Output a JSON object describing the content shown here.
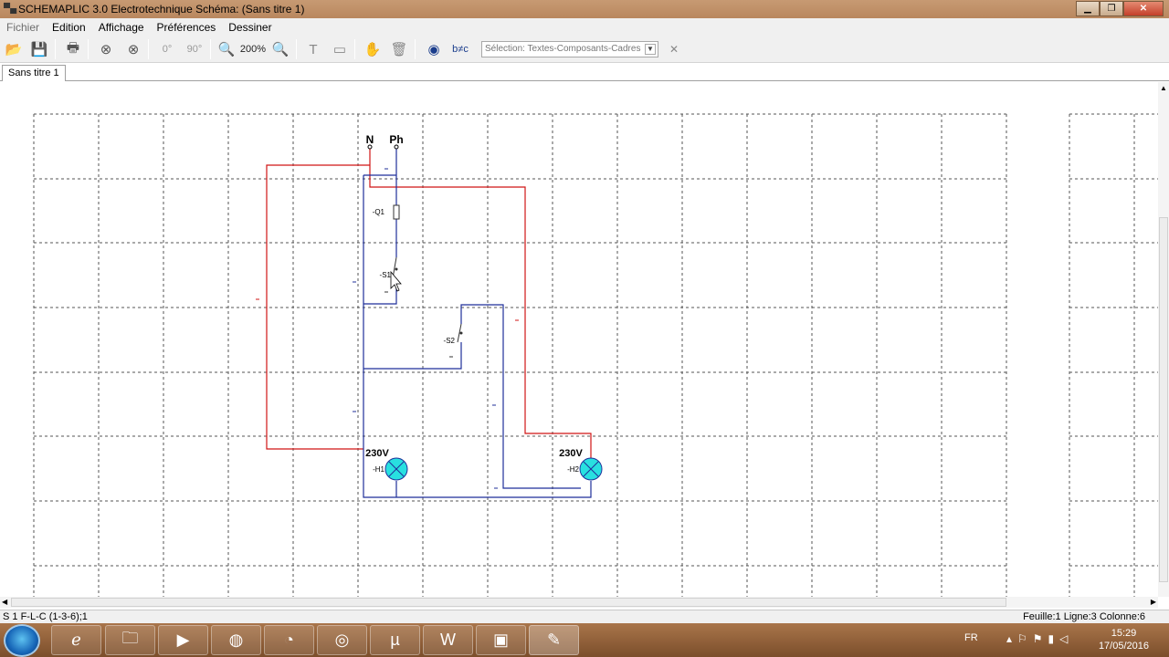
{
  "window": {
    "title": "SCHEMAPLIC 3.0 Electrotechnique Schéma: (Sans titre  1)"
  },
  "menu": {
    "items": [
      "Fichier",
      "Edition",
      "Affichage",
      "Préférences",
      "Dessiner"
    ]
  },
  "toolbar": {
    "angle0": "0°",
    "angle90": "90°",
    "zoom": "200%",
    "selection": "Sélection: Textes-Composants-Cadres"
  },
  "tab": {
    "label": "Sans titre 1"
  },
  "schematic": {
    "neutral": "N",
    "phase": "Ph",
    "q1": "-Q1",
    "s1": "-S1",
    "s2": "-S2",
    "h1": "-H1",
    "h2": "-H2",
    "voltage1": "230V",
    "voltage2": "230V"
  },
  "status": {
    "left": "S 1  F-L-C  (1-3-6);1",
    "right": "Feuille:1 Ligne:3 Colonne:6"
  },
  "taskbar": {
    "lang": "FR",
    "time": "15:29",
    "date": "17/05/2016"
  },
  "colors": {
    "phase_wire": "#d01414",
    "neutral_wire": "#1f2f9a",
    "lamp": "#28e0e0",
    "grid": "#555555"
  }
}
